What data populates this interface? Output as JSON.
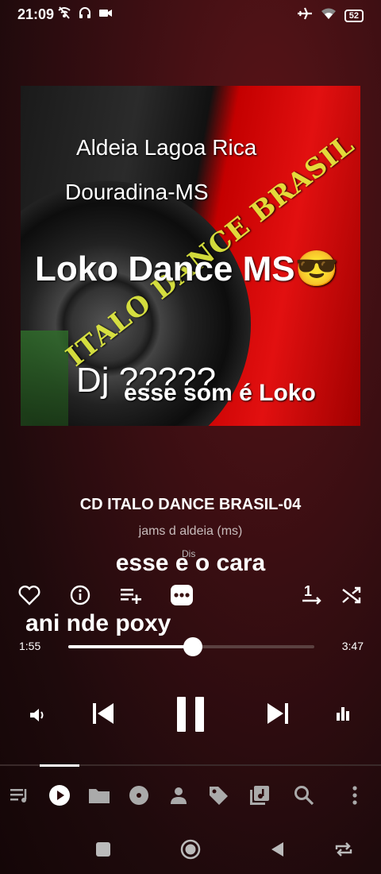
{
  "status": {
    "time": "21:09",
    "battery": "52",
    "icons_left": [
      "wifi-off-icon",
      "headphones-icon",
      "video-icon"
    ],
    "icons_right": [
      "airplane-icon",
      "wifi-icon",
      "battery-icon"
    ]
  },
  "artwork": {
    "line1": "Aldeia Lagoa Rica",
    "line2": "Douradina-MS",
    "title": "Loko Dance MS😎",
    "diagonal": "ITALO DANCE BRASIL",
    "dj": "Dj ?????",
    "slogan": "esse som é Loko"
  },
  "track": {
    "title": "CD ITALO DANCE BRASIL-04",
    "artist": "jams d aldeia (ms)"
  },
  "lyrics": {
    "line1": "esse e o cara",
    "overlay": "Dis",
    "line2": "ani nde poxy"
  },
  "actions": [
    "favorite-icon",
    "info-icon",
    "add-to-queue-icon",
    "more-icon",
    "repeat-one-icon",
    "shuffle-icon"
  ],
  "progress": {
    "current": "1:55",
    "total": "3:47",
    "fraction": 0.507
  },
  "controls": [
    "volume-icon",
    "previous-icon",
    "pause-icon",
    "next-icon",
    "equalizer-icon"
  ],
  "tabs": [
    "queue",
    "now-playing",
    "folders",
    "albums",
    "artists",
    "genres",
    "playlists",
    "search",
    "menu"
  ],
  "active_tab": 1,
  "colors": {
    "accent": "#ffffff",
    "background": "#3a0e12"
  }
}
